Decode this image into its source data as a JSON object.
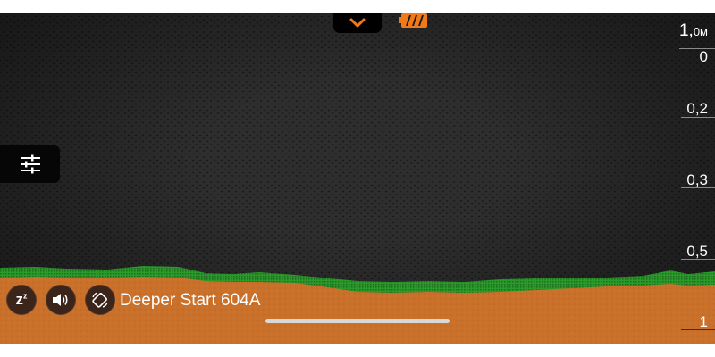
{
  "colors": {
    "accent": "#f07a1a",
    "bottom": "#c9702a",
    "vegetation": "#2a9a2a",
    "background": "#1a1a1a"
  },
  "top": {
    "collapse_icon": "chevron-down-icon",
    "battery_icon": "battery-icon"
  },
  "depth_scale": {
    "max_label": "1,",
    "unit": "0м",
    "labels": [
      "0",
      "0,2",
      "0,3",
      "0,5",
      "1"
    ]
  },
  "controls": {
    "settings_icon": "sliders-icon",
    "sleep_label": "z",
    "sleep_sup": "z",
    "sound_icon": "speaker-icon",
    "rotate_icon": "rotate-icon"
  },
  "device": {
    "name": "Deeper Start 604A"
  }
}
